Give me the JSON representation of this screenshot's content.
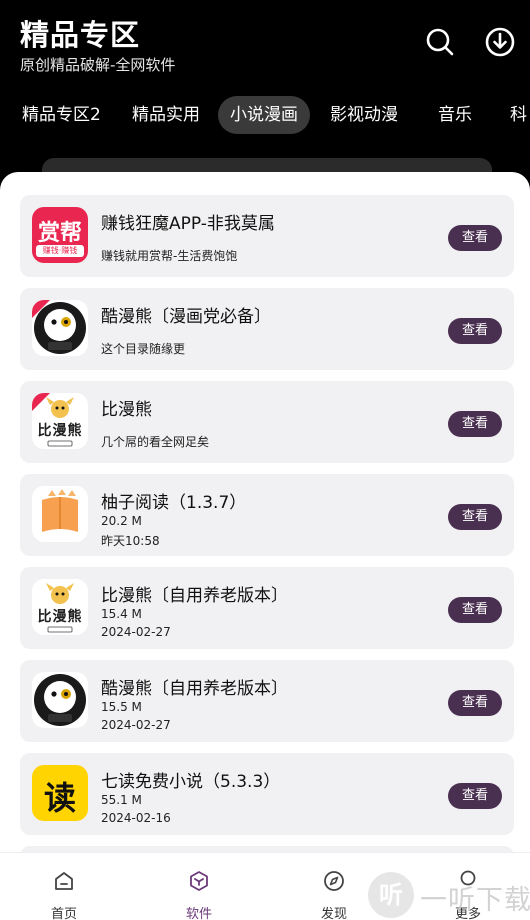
{
  "header": {
    "title": "精品专区",
    "subtitle": "原创精品破解-全网软件"
  },
  "tabs": [
    {
      "label": "精品专区2"
    },
    {
      "label": "精品实用"
    },
    {
      "label": "小说漫画",
      "active": true
    },
    {
      "label": "影视动漫"
    },
    {
      "label": "音乐"
    },
    {
      "label": "科"
    }
  ],
  "apps": [
    {
      "name": "赚钱狂魔APP-非我莫属",
      "line1": "赚钱就用赏帮-生活费饱饱",
      "line2": "",
      "button": "查看",
      "icon": "shangbang-app-icon",
      "icon_text": "赏帮",
      "icon_sub": "赚钱·赚钱"
    },
    {
      "name": "酷漫熊〔漫画党必备〕",
      "line1": "这个目录随缘更",
      "line2": "",
      "button": "查看",
      "icon": "kumanxiong-app-icon"
    },
    {
      "name": "比漫熊",
      "line1": "几个屌的看全网足矣",
      "line2": "",
      "button": "查看",
      "icon": "bimanxiong-app-icon",
      "icon_text": "比漫熊"
    },
    {
      "name": "柚子阅读（1.3.7）",
      "line1": "20.2 M",
      "line2": "昨天10:58",
      "button": "查看",
      "icon": "book-app-icon"
    },
    {
      "name": "比漫熊〔自用养老版本〕",
      "line1": "15.4 M",
      "line2": "2024-02-27",
      "button": "查看",
      "icon": "bimanxiong-app-icon",
      "icon_text": "比漫熊"
    },
    {
      "name": "酷漫熊〔自用养老版本〕",
      "line1": "15.5 M",
      "line2": "2024-02-27",
      "button": "查看",
      "icon": "kumanxiong-app-icon"
    },
    {
      "name": "七读免费小说（5.3.3）",
      "line1": "55.1 M",
      "line2": "2024-02-16",
      "button": "查看",
      "icon": "qidu-app-icon",
      "icon_text": "读"
    }
  ],
  "tabbar": [
    {
      "label": "首页",
      "icon": "home-icon"
    },
    {
      "label": "软件",
      "icon": "software-icon",
      "active": true
    },
    {
      "label": "发现",
      "icon": "compass-icon"
    },
    {
      "label": "更多",
      "icon": "user-icon"
    }
  ],
  "watermark": {
    "glyph": "听",
    "text": "一听下载"
  },
  "colors": {
    "accent": "#4a3050",
    "active_tab": "#6b3a7a",
    "header_bg": "#000000",
    "card_bg": "#f1f1f3"
  }
}
